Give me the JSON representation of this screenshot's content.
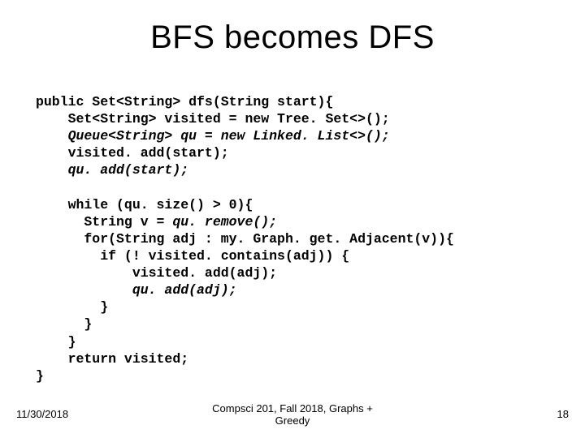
{
  "title": "BFS becomes DFS",
  "code": {
    "l1": "public Set<String> dfs(String start){",
    "l2": "    Set<String> visited = new Tree. Set<>();",
    "l3": "    Queue<String> qu = new Linked. List<>();",
    "l4": "    visited. add(start);",
    "l5": "    qu. add(start);",
    "blank1": "",
    "l6": "    while (qu. size() > 0){",
    "l7": "      String v = ",
    "l7b": "qu. remove();",
    "l8": "      for(String adj : my. Graph. get. Adjacent(v)){",
    "l9": "        if (! visited. contains(adj)) {",
    "l10": "            visited. add(adj);",
    "l11": "            qu. add(adj);",
    "l12": "        }",
    "l13": "      }",
    "l14": "    }",
    "l15": "    return visited;",
    "l16": "}"
  },
  "footer": {
    "date": "11/30/2018",
    "center": "Compsci 201, Fall 2018, Graphs +\nGreedy",
    "page": "18"
  }
}
